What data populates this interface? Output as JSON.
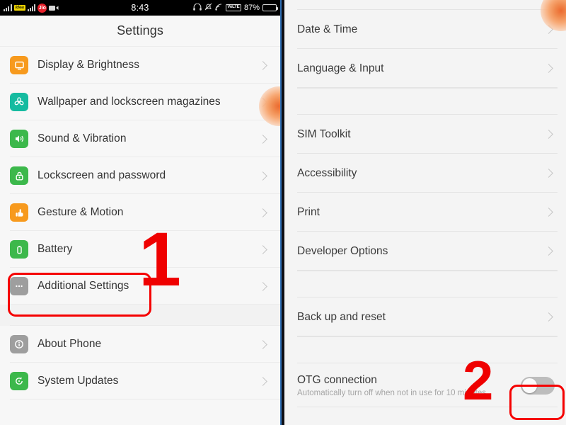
{
  "statusbar": {
    "time": "8:43",
    "battery_percent": "87%",
    "carrier1": "Idea",
    "carrier2": "Jio",
    "volte": "VoLTE",
    "icons": [
      "signal-bars-icon",
      "carrier-idea-icon",
      "signal-bars-icon",
      "carrier-jio-icon",
      "video-camera-icon",
      "headphones-icon",
      "alarm-muted-icon",
      "cast-icon",
      "volte-icon",
      "battery-icon"
    ]
  },
  "left_panel": {
    "title": "Settings",
    "groups": [
      {
        "items": [
          {
            "label": "Display & Brightness",
            "icon": "monitor-icon",
            "icon_color": "#f79a1e"
          },
          {
            "label": "Wallpaper and lockscreen magazines",
            "icon": "flower-icon",
            "icon_color": "#15bba0"
          },
          {
            "label": "Sound & Vibration",
            "icon": "speaker-icon",
            "icon_color": "#3cb84b"
          },
          {
            "label": "Lockscreen and password",
            "icon": "lock-icon",
            "icon_color": "#3cb84b"
          },
          {
            "label": "Gesture & Motion",
            "icon": "hand-gesture-icon",
            "icon_color": "#f79a1e"
          },
          {
            "label": "Battery",
            "icon": "battery-icon",
            "icon_color": "#3cb84b"
          },
          {
            "label": "Additional Settings",
            "icon": "ellipsis-icon",
            "icon_color": "#9e9e9e"
          }
        ]
      },
      {
        "items": [
          {
            "label": "About Phone",
            "icon": "info-icon",
            "icon_color": "#9e9e9e"
          },
          {
            "label": "System Updates",
            "icon": "refresh-icon",
            "icon_color": "#3cb84b"
          }
        ]
      }
    ]
  },
  "right_panel": {
    "groups": [
      {
        "items": [
          {
            "label": "Date & Time"
          },
          {
            "label": "Language & Input"
          }
        ]
      },
      {
        "items": [
          {
            "label": "SIM Toolkit"
          },
          {
            "label": "Accessibility"
          },
          {
            "label": "Print"
          },
          {
            "label": "Developer Options"
          }
        ]
      },
      {
        "items": [
          {
            "label": "Back up and reset"
          }
        ]
      }
    ],
    "otg": {
      "label": "OTG connection",
      "subtitle": "Automatically turn off when not in use for 10 minutes",
      "toggle_state": "off"
    }
  },
  "annotations": {
    "step1": "1",
    "step2": "2",
    "highlight_color": "#f50000"
  }
}
